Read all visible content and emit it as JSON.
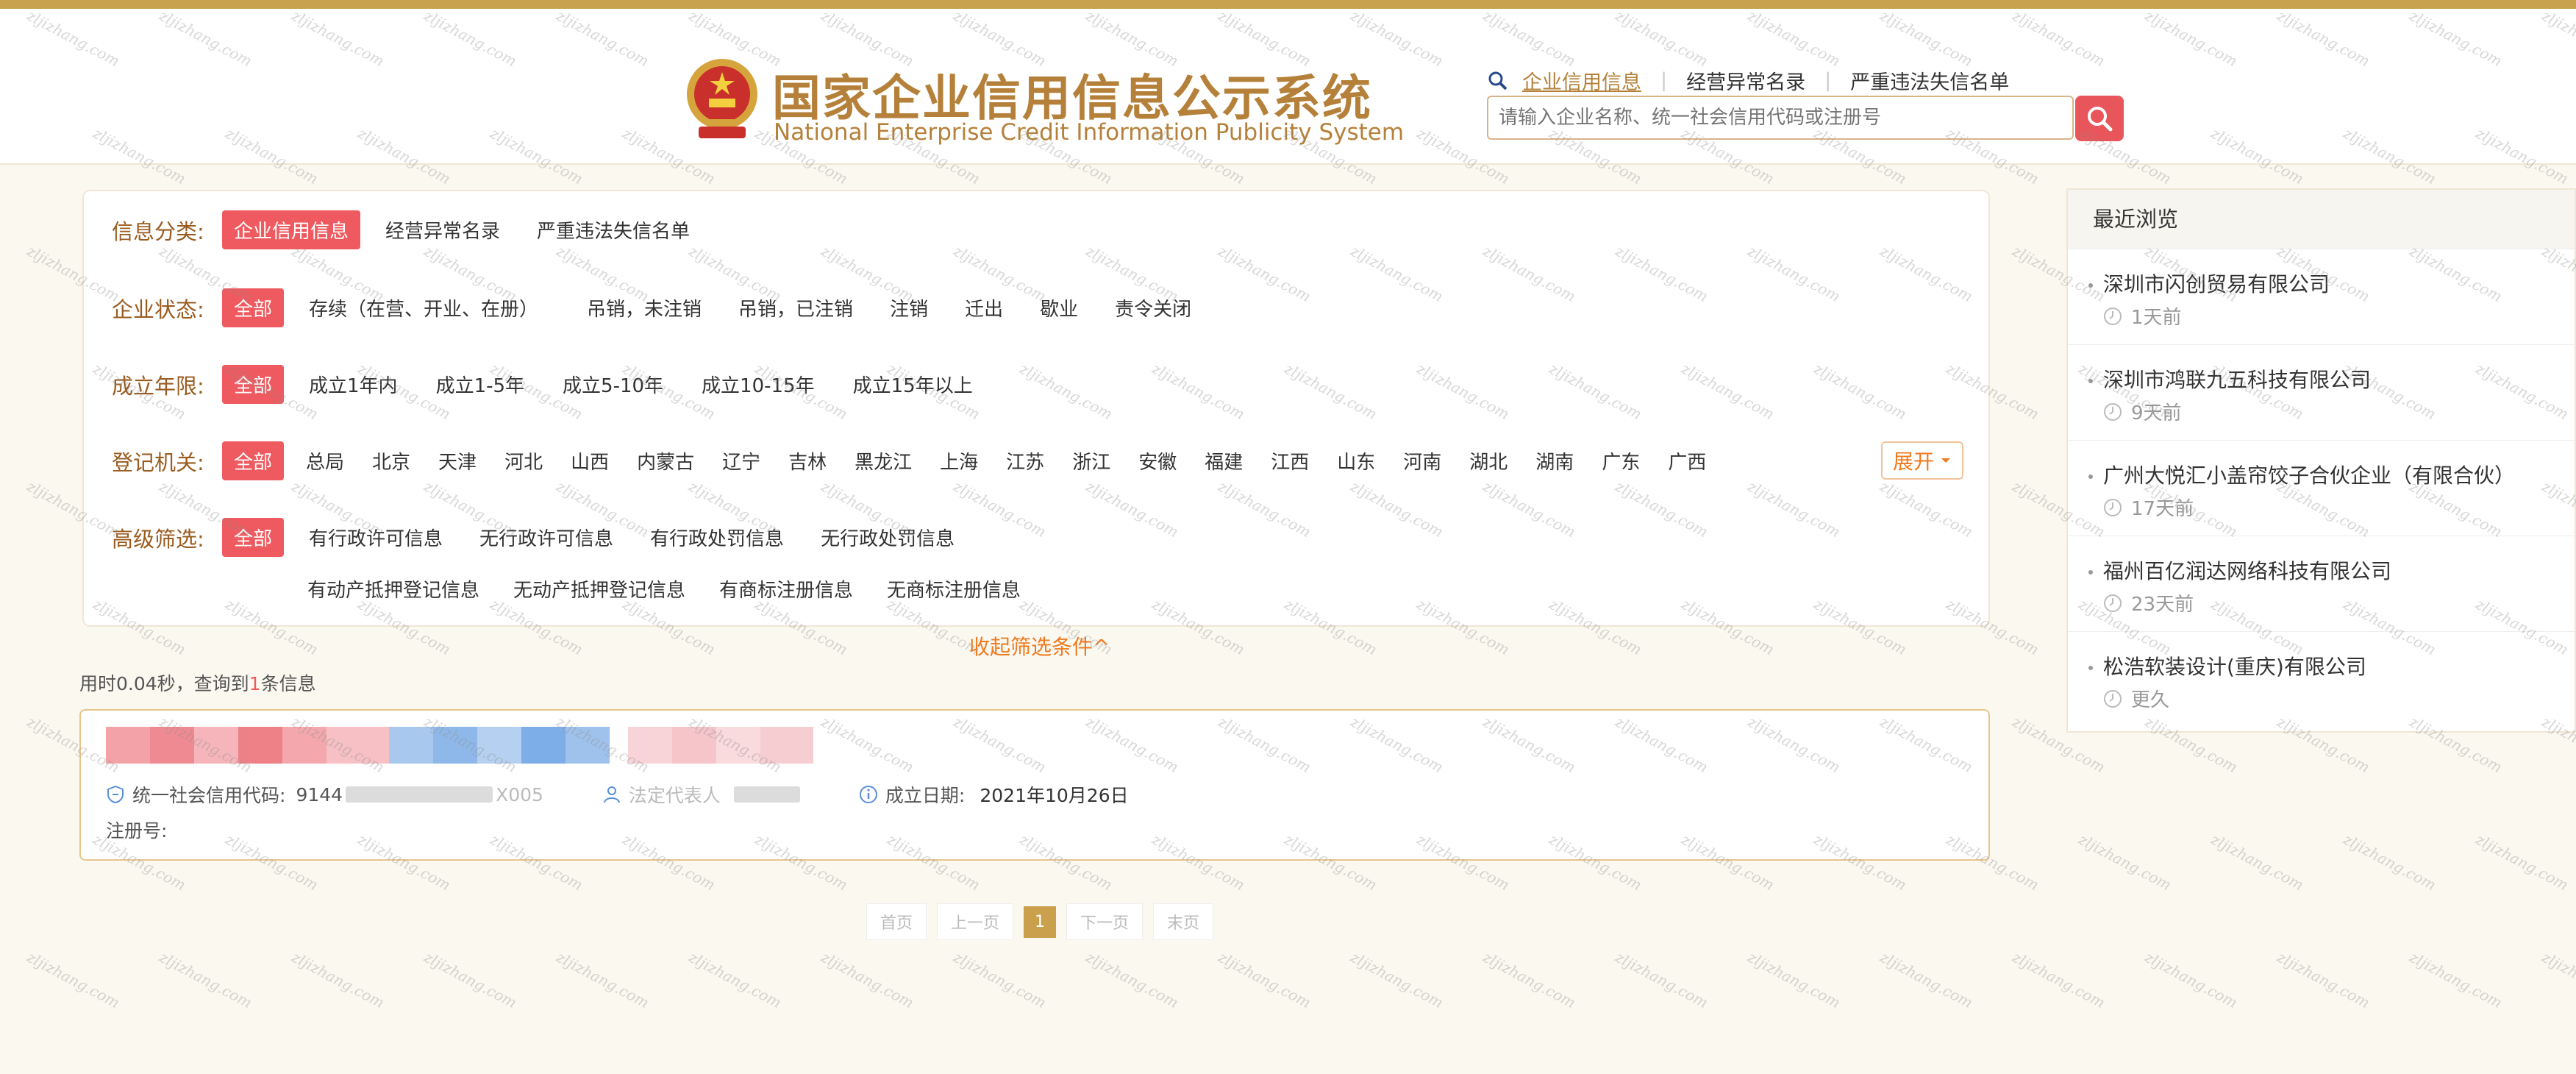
{
  "header": {
    "title_cn": "国家企业信用信息公示系统",
    "title_en": "National Enterprise Credit Information Publicity System",
    "search_tabs": [
      "企业信用信息",
      "经营异常名录",
      "严重违法失信名单"
    ],
    "search_placeholder": "请输入企业名称、统一社会信用代码或注册号"
  },
  "filters": {
    "category": {
      "label": "信息分类:",
      "options": [
        "企业信用信息",
        "经营异常名录",
        "严重违法失信名单"
      ]
    },
    "status": {
      "label": "企业状态:",
      "options": [
        "全部",
        "存续（在营、开业、在册）",
        "吊销，未注销",
        "吊销，已注销",
        "注销",
        "迁出",
        "歇业",
        "责令关闭"
      ]
    },
    "years": {
      "label": "成立年限:",
      "options": [
        "全部",
        "成立1年内",
        "成立1-5年",
        "成立5-10年",
        "成立10-15年",
        "成立15年以上"
      ]
    },
    "authority": {
      "label": "登记机关:",
      "options": [
        "全部",
        "总局",
        "北京",
        "天津",
        "河北",
        "山西",
        "内蒙古",
        "辽宁",
        "吉林",
        "黑龙江",
        "上海",
        "江苏",
        "浙江",
        "安徽",
        "福建",
        "江西",
        "山东",
        "河南",
        "湖北",
        "湖南",
        "广东",
        "广西"
      ]
    },
    "advanced": {
      "label": "高级筛选:",
      "options_row1": [
        "全部",
        "有行政许可信息",
        "无行政许可信息",
        "有行政处罚信息",
        "无行政处罚信息"
      ],
      "options_row2": [
        "有动产抵押登记信息",
        "无动产抵押登记信息",
        "有商标注册信息",
        "无商标注册信息"
      ]
    },
    "expand_label": "展开",
    "collapse_label": "收起筛选条件^"
  },
  "results": {
    "summary_prefix": "用时0.04秒，查询到",
    "summary_count": "1",
    "summary_suffix": "条信息",
    "card": {
      "credit_code_label": "统一社会信用代码:",
      "credit_code_prefix": "9144",
      "credit_code_suffix": "X005",
      "legal_rep_label": "法定代表人",
      "founded_label": "成立日期:",
      "founded_value": "2021年10月26日",
      "reg_no_label": "注册号:"
    }
  },
  "pagination": {
    "first": "首页",
    "prev": "上一页",
    "current": "1",
    "next": "下一页",
    "last": "末页"
  },
  "recent": {
    "title": "最近浏览",
    "items": [
      {
        "name": "深圳市闪创贸易有限公司",
        "time": "1天前"
      },
      {
        "name": "深圳市鸿联九五科技有限公司",
        "time": "9天前"
      },
      {
        "name": "广州大悦汇小盖帘饺子合伙企业（有限合伙）",
        "time": "17天前"
      },
      {
        "name": "福州百亿润达网络科技有限公司",
        "time": "23天前"
      },
      {
        "name": "松浩软装设计(重庆)有限公司",
        "time": "更久"
      }
    ]
  },
  "watermark_text": "zljizhang.com",
  "colors": {
    "accent_red": "#ee5a5f",
    "brand_gold": "#b5813a",
    "orange": "#f07a1e",
    "border_gold": "#e7c68c"
  }
}
